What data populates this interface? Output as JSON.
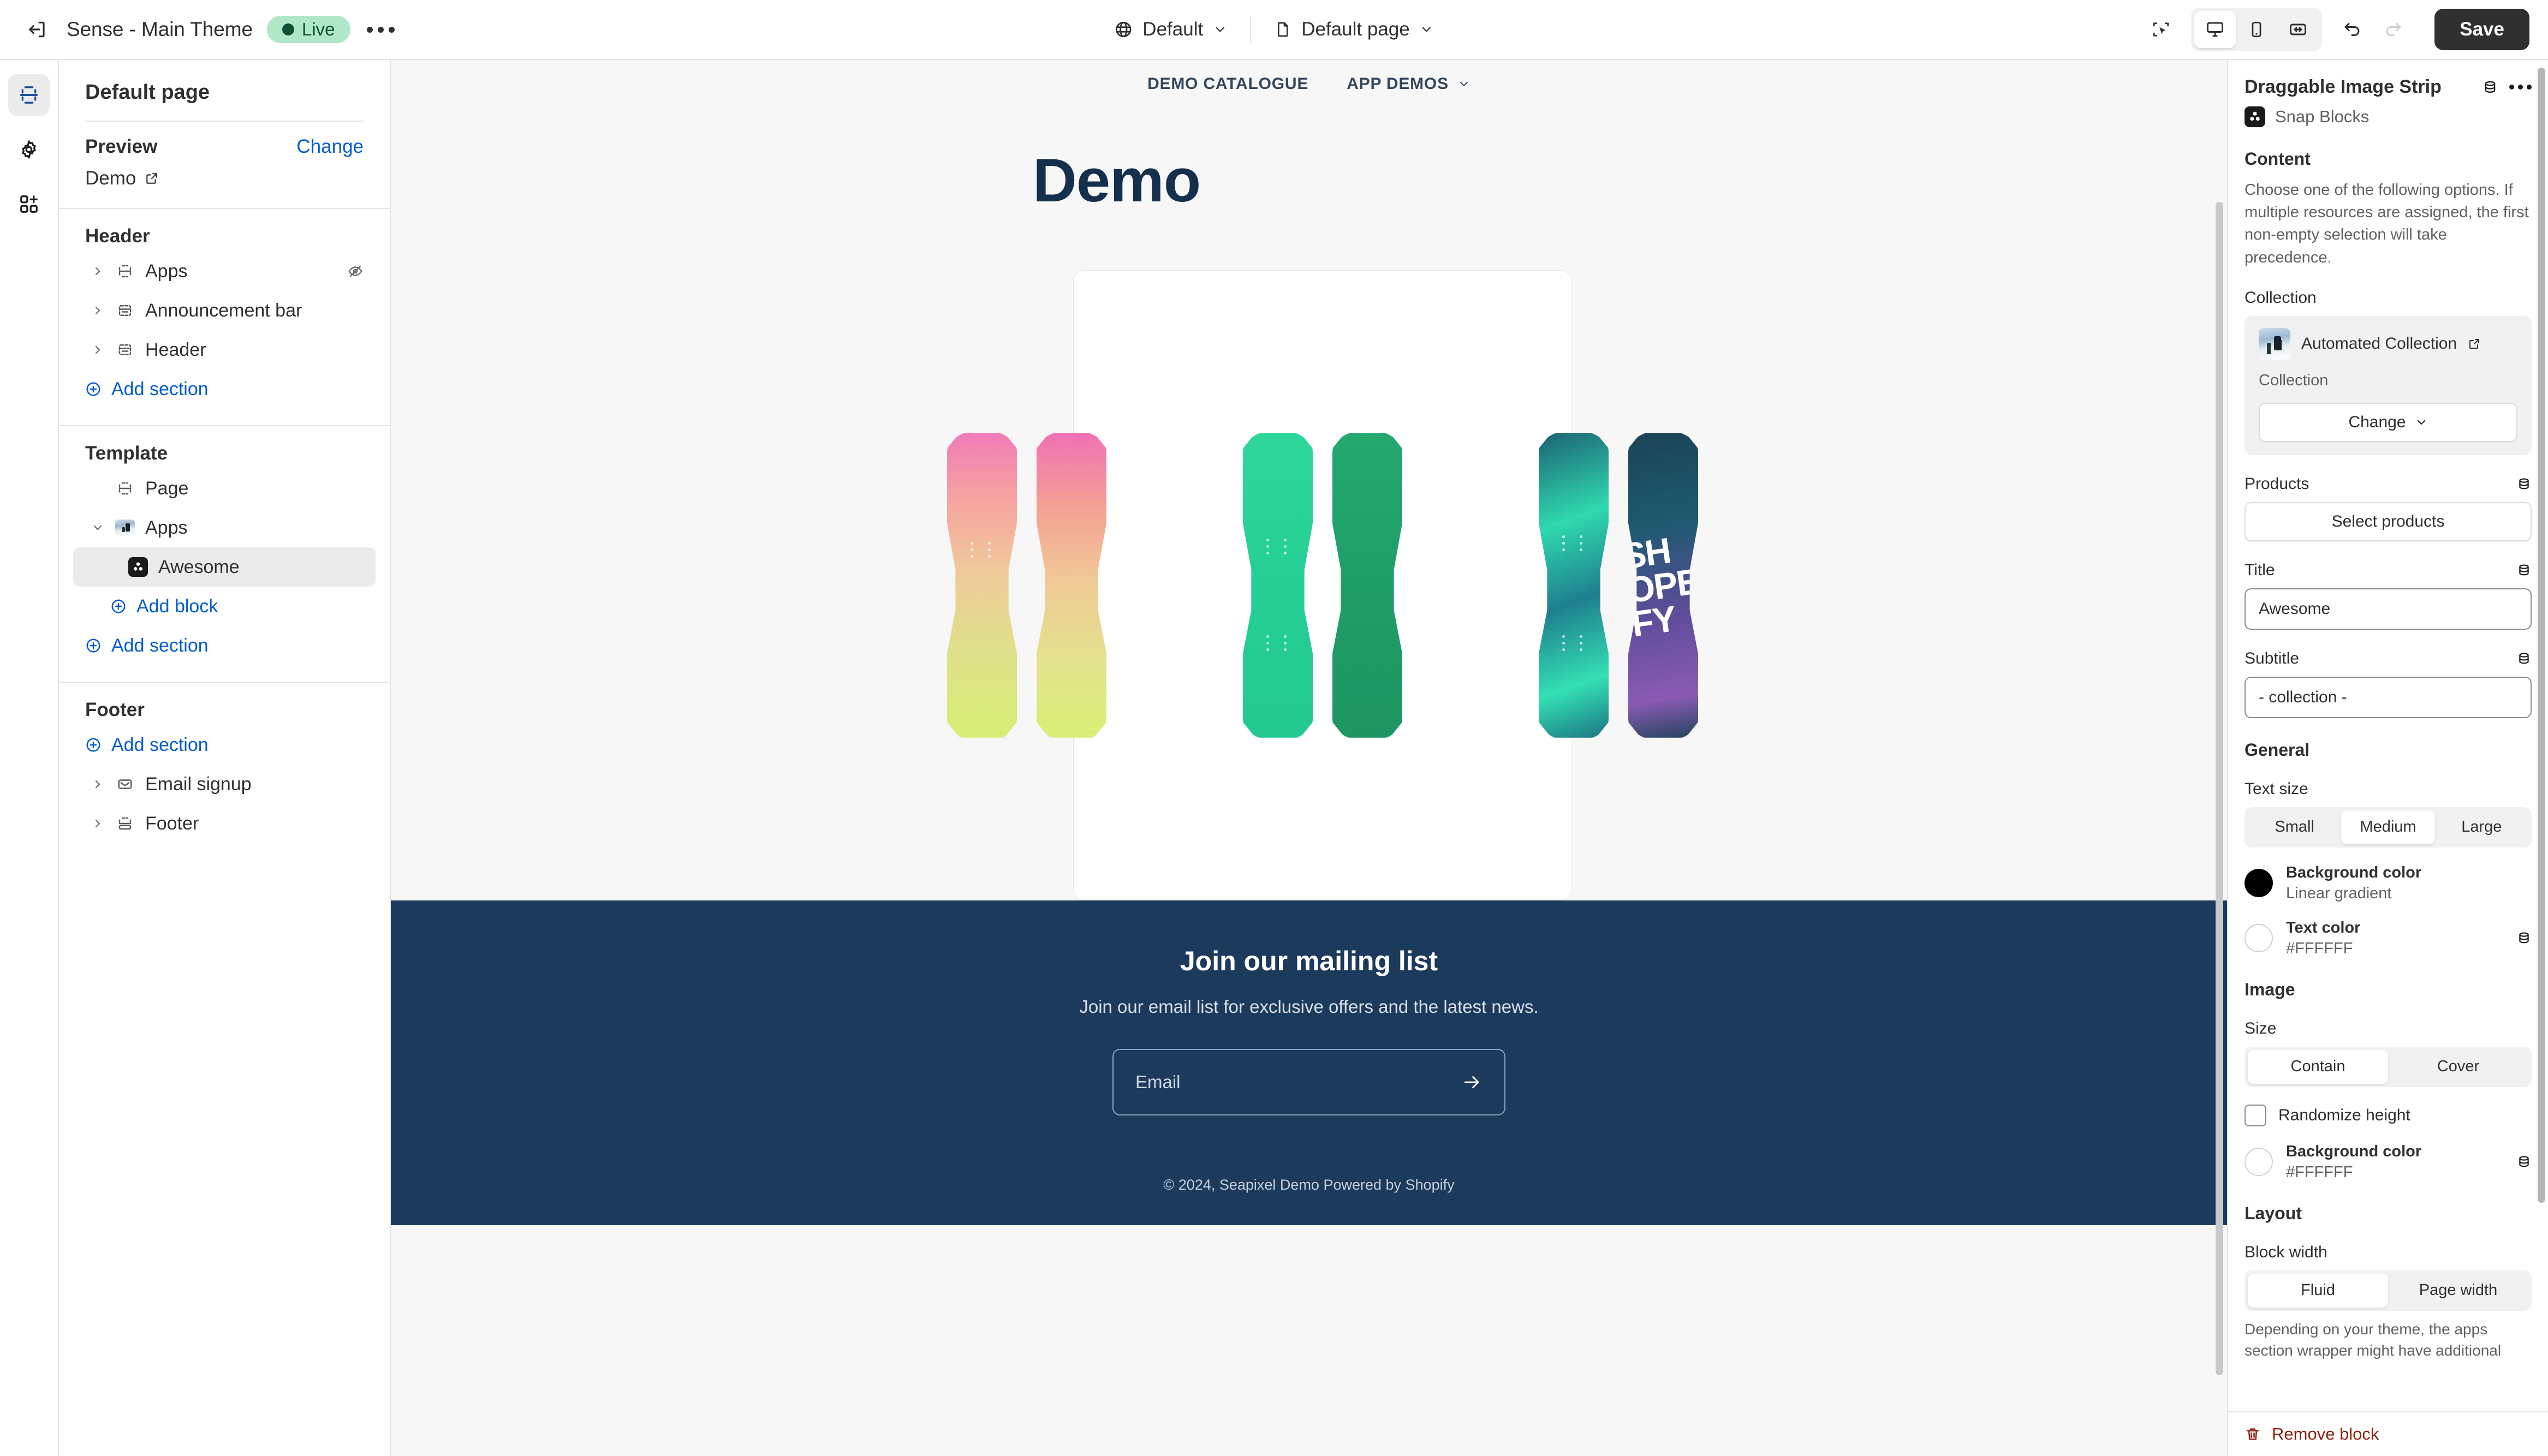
{
  "topbar": {
    "exit_icon": "exit-icon",
    "theme_name": "Sense - Main Theme",
    "status_badge": "Live",
    "more_icon": "more-horizontal-icon",
    "locale_icon": "globe-icon",
    "locale_label": "Default",
    "page_icon": "page-icon",
    "page_label": "Default page",
    "inspector_icon": "inspector-select-icon",
    "devices": [
      {
        "name": "desktop-icon",
        "label": "Desktop",
        "active": true
      },
      {
        "name": "mobile-icon",
        "label": "Mobile",
        "active": false
      },
      {
        "name": "fullscreen-icon",
        "label": "Full width",
        "active": false
      }
    ],
    "undo_icon": "undo-icon",
    "redo_icon": "redo-icon",
    "save_label": "Save"
  },
  "rail": [
    {
      "name": "sections-icon",
      "active": true
    },
    {
      "name": "gear-icon",
      "active": false
    },
    {
      "name": "apps-add-icon",
      "active": false
    }
  ],
  "sidebar": {
    "title": "Default page",
    "preview_label": "Preview",
    "change_label": "Change",
    "preview_value": "Demo",
    "external_link_icon": "external-link-icon",
    "groups": [
      {
        "title": "Header",
        "items": [
          {
            "label": "Apps",
            "icon": "section-apps-icon",
            "caret": "chevron-right-icon",
            "hidden_icon": "eye-off-icon",
            "indent": 0,
            "selected": false
          },
          {
            "label": "Announcement bar",
            "icon": "section-bar-icon",
            "caret": "chevron-right-icon",
            "indent": 0,
            "selected": false
          },
          {
            "label": "Header",
            "icon": "section-bar-icon",
            "caret": "chevron-right-icon",
            "indent": 0,
            "selected": false
          }
        ],
        "add_label": "Add section",
        "add_indent": 0
      },
      {
        "title": "Template",
        "items": [
          {
            "label": "Page",
            "icon": "section-page-icon",
            "caret": "",
            "indent": 1,
            "selected": false
          },
          {
            "label": "Apps",
            "icon": "thumb-collection-icon",
            "caret": "chevron-down-icon",
            "indent": 0,
            "selected": false
          },
          {
            "label": "Awesome",
            "icon": "snap-blocks-icon",
            "caret": "",
            "indent": 2,
            "selected": true
          }
        ],
        "add_block_label": "Add block",
        "add_label": "Add section",
        "add_indent": 0
      },
      {
        "title": "Footer",
        "add_label": "Add section",
        "items": [
          {
            "label": "Email signup",
            "icon": "envelope-icon",
            "caret": "chevron-right-icon",
            "indent": 0,
            "selected": false
          },
          {
            "label": "Footer",
            "icon": "section-footer-icon",
            "caret": "chevron-right-icon",
            "indent": 0,
            "selected": false
          }
        ]
      }
    ]
  },
  "preview": {
    "nav": [
      {
        "label": "DEMO CATALOGUE",
        "caret": false
      },
      {
        "label": "APP DEMOS",
        "caret": true
      }
    ],
    "heading": "Demo",
    "boards": [
      {
        "name": "pink-gradient-board-front",
        "style": "b-pinkA"
      },
      {
        "name": "pink-gradient-board-back",
        "style": "b-pinkB"
      },
      {
        "name": "green-board-front",
        "style": "b-greenA"
      },
      {
        "name": "green-pixel-board-back",
        "style": "b-greenB"
      },
      {
        "name": "teal-board-front",
        "style": "b-tealA"
      },
      {
        "name": "shopify-typography-board-back",
        "style": "b-purpA",
        "text": "SH\nOPE\nFY"
      }
    ],
    "footer": {
      "heading": "Join our mailing list",
      "subtext": "Join our email list for exclusive offers and the latest news.",
      "email_placeholder": "Email",
      "submit_icon": "arrow-right-icon",
      "copyright": "© 2024, Seapixel Demo Powered by Shopify"
    }
  },
  "panel": {
    "title": "Draggable Image Strip",
    "database_icon": "database-icon",
    "more_icon": "more-horizontal-icon",
    "app_badge_icon": "snap-blocks-icon",
    "app_name": "Snap Blocks",
    "content": {
      "section_title": "Content",
      "description": "Choose one of the following options. If multiple resources are assigned, the first non-empty selection will take precedence.",
      "collection_label": "Collection",
      "collection_name": "Automated Collection",
      "collection_external_icon": "external-link-icon",
      "collection_type": "Collection",
      "change_label": "Change",
      "change_caret_icon": "chevron-down-icon",
      "products_label": "Products",
      "select_products_label": "Select products",
      "title_label": "Title",
      "title_value": "Awesome",
      "subtitle_label": "Subtitle",
      "subtitle_value": "- collection -"
    },
    "general": {
      "section_title": "General",
      "text_size_label": "Text size",
      "text_size_options": [
        "Small",
        "Medium",
        "Large"
      ],
      "text_size_selected": "Medium",
      "background_color_name": "Background color",
      "background_color_value": "Linear gradient",
      "background_color_hex": "#000000",
      "text_color_name": "Text color",
      "text_color_value": "#FFFFFF",
      "text_color_hex": "#FFFFFF"
    },
    "image": {
      "section_title": "Image",
      "size_label": "Size",
      "size_options": [
        "Contain",
        "Cover"
      ],
      "size_selected": "Contain",
      "randomize_label": "Randomize height",
      "randomize_checked": false,
      "background_color_name": "Background color",
      "background_color_value": "#FFFFFF",
      "background_color_hex": "#FFFFFF"
    },
    "layout": {
      "section_title": "Layout",
      "block_width_label": "Block width",
      "block_width_options": [
        "Fluid",
        "Page width"
      ],
      "block_width_selected": "Fluid",
      "hint": "Depending on your theme, the apps section wrapper might have additional"
    },
    "remove_label": "Remove block",
    "remove_icon": "trash-icon"
  }
}
